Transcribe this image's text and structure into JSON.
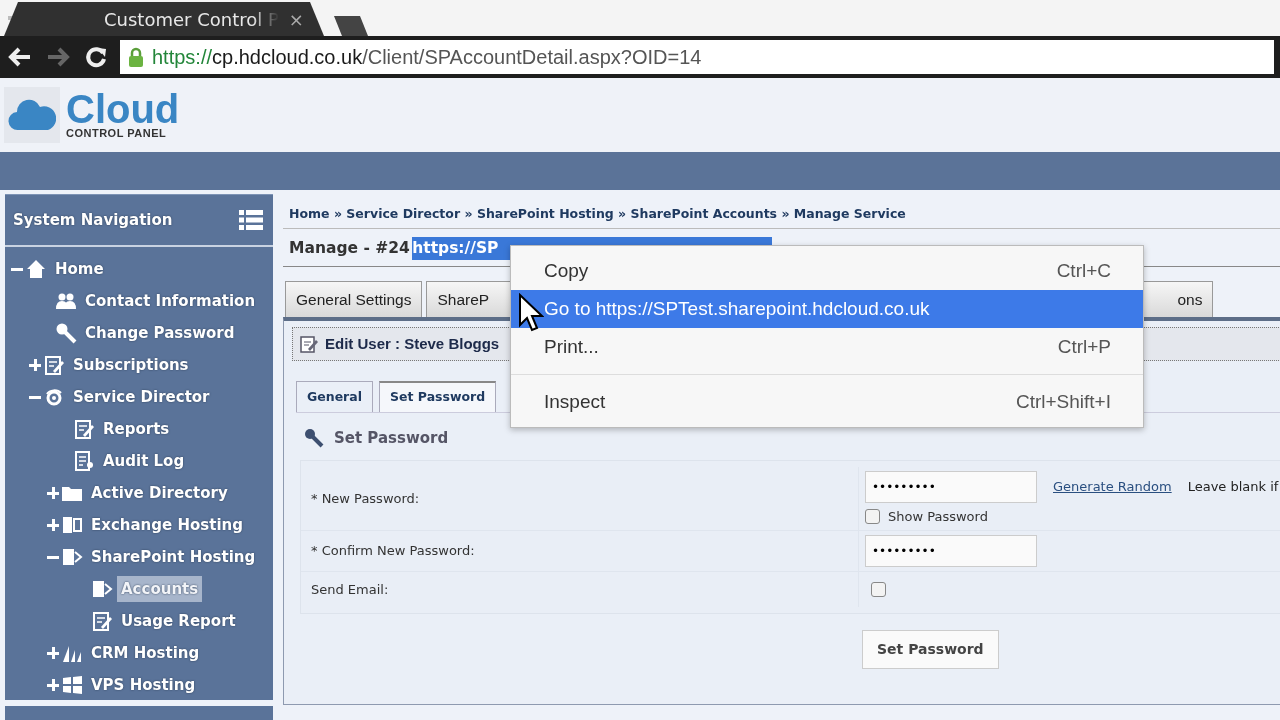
{
  "browser": {
    "tab": {
      "title": "Customer Control P",
      "close": "×"
    },
    "url": {
      "scheme": "https://",
      "host": "cp.hdcloud.co.uk",
      "path": "/Client/SPAccountDetail.aspx?OID=14"
    }
  },
  "logo": {
    "title": "Cloud",
    "subtitle": "CONTROL PANEL"
  },
  "sidebar": {
    "title": "System Navigation",
    "items": [
      {
        "label": "Home",
        "expanded": true,
        "selected": false,
        "children": [
          {
            "label": "Contact Information",
            "selected": false
          },
          {
            "label": "Change Password",
            "selected": false
          },
          {
            "label": "Subscriptions",
            "expanded": false,
            "selected": false
          },
          {
            "label": "Service Director",
            "expanded": true,
            "selected": false,
            "children": [
              {
                "label": "Reports",
                "selected": false
              },
              {
                "label": "Audit Log",
                "selected": false
              },
              {
                "label": "Active Directory",
                "expanded": false,
                "selected": false
              },
              {
                "label": "Exchange Hosting",
                "expanded": false,
                "selected": false
              },
              {
                "label": "SharePoint Hosting",
                "expanded": true,
                "selected": false,
                "children": [
                  {
                    "label": "Accounts",
                    "selected": true
                  },
                  {
                    "label": "Usage Report",
                    "selected": false
                  }
                ]
              },
              {
                "label": "CRM Hosting",
                "expanded": false,
                "selected": false
              },
              {
                "label": "VPS Hosting",
                "expanded": false,
                "selected": false
              }
            ]
          }
        ]
      }
    ]
  },
  "breadcrumb": {
    "separator": "»",
    "links": [
      "Home",
      "Service Director",
      "SharePoint Hosting",
      "SharePoint Accounts"
    ],
    "current": "Manage Service"
  },
  "page_title": {
    "text": "Manage - #24",
    "selection": "https://SP"
  },
  "tabs": [
    {
      "label": "General Settings",
      "selected": false
    },
    {
      "label": "ShareP",
      "selected": false
    },
    {
      "label": "ons",
      "selected": false
    }
  ],
  "panel": {
    "title": "Edit User : Steve Bloggs",
    "subtabs": [
      {
        "label": "General",
        "selected": false
      },
      {
        "label": "Set Password",
        "selected": true
      }
    ],
    "section": "Set Password",
    "rows": [
      {
        "kind": "password",
        "label": "* New Password:",
        "value": "•••••••••",
        "show": {
          "label": "Show Password",
          "checked": false
        },
        "link": "Generate Random",
        "hint": "Leave blank if"
      },
      {
        "kind": "password",
        "label": "* Confirm New Password:",
        "value": "•••••••••"
      },
      {
        "kind": "checkbox",
        "label": "Send Email:",
        "checked": false
      }
    ],
    "submit": "Set Password"
  },
  "context_menu": {
    "items": [
      {
        "kind": "item",
        "label": "Copy",
        "shortcut": "Ctrl+C",
        "selected": false
      },
      {
        "kind": "item",
        "label": "Go to https://SPTest.sharepoint.hdcloud.co.uk",
        "selected": true
      },
      {
        "kind": "item",
        "label": "Print...",
        "shortcut": "Ctrl+P",
        "selected": false
      },
      {
        "kind": "separator"
      },
      {
        "kind": "item",
        "label": "Inspect",
        "shortcut": "Ctrl+Shift+I",
        "selected": false
      }
    ]
  }
}
